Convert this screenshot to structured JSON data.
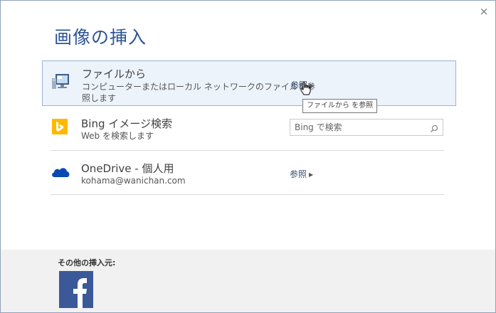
{
  "dialog": {
    "title": "画像の挿入",
    "close_label": "×"
  },
  "sources": [
    {
      "title": "ファイルから",
      "description_line1": "コンピューターまたはローカル ネットワークのファイルを参",
      "description_line2": "照します",
      "action_label": "参照",
      "icon": "computer-icon"
    },
    {
      "title": "Bing イメージ検索",
      "description": "Web を検索します",
      "search_placeholder": "Bing で検索",
      "icon": "bing-icon"
    },
    {
      "title": "OneDrive - 個人用",
      "description": "kohama@wanichan.com",
      "action_label": "参照",
      "icon": "onedrive-icon"
    }
  ],
  "tooltip": "ファイルから を参照",
  "footer": {
    "label": "その他の挿入元:",
    "icon": "facebook-icon"
  },
  "colors": {
    "title": "#2e5597",
    "selected_row_bg": "#edf3fb",
    "selected_row_border": "#98b4d8",
    "bing": "#ffb900",
    "onedrive": "#094ab2",
    "facebook": "#3b5998"
  }
}
